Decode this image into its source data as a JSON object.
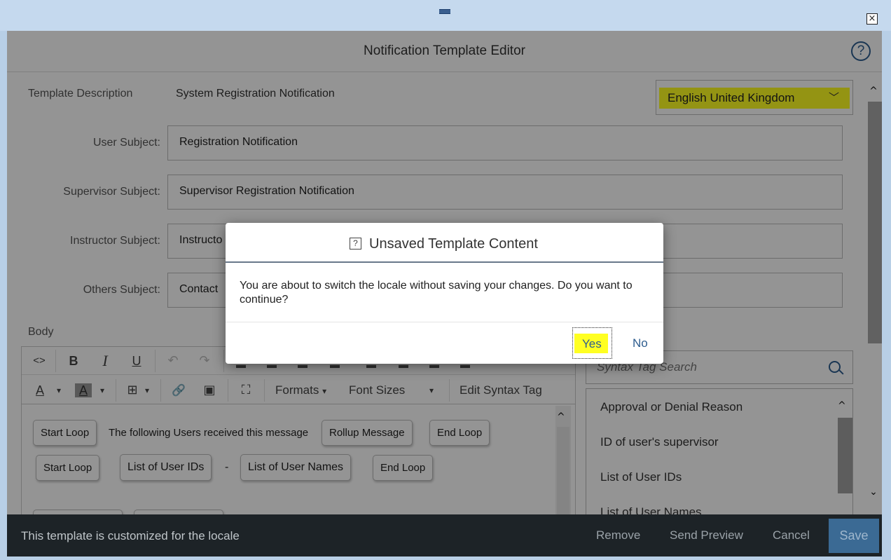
{
  "window": {
    "close_symbol": "×",
    "grip_icon": "drag-handle-icon"
  },
  "editor": {
    "title": "Notification Template Editor",
    "help_symbol": "?",
    "template_description_label": "Template Description",
    "template_description_value": "System Registration Notification",
    "locale_value": "English United Kingdom",
    "locale_chevron": "﹀",
    "fields": [
      {
        "label": "User Subject:",
        "value": "Registration Notification"
      },
      {
        "label": "Supervisor Subject:",
        "value": "Supervisor Registration Notification"
      },
      {
        "label": "Instructor Subject:",
        "value": "Instructo"
      },
      {
        "label": "Others Subject:",
        "value": "Contact"
      }
    ],
    "body_label": "Body",
    "scroll_up": "^",
    "scroll_down": "⌄"
  },
  "toolbar": {
    "source_code": "<>",
    "bold": "B",
    "italic": "I",
    "underline": "U",
    "undo": "↶",
    "redo": "↷",
    "font_color": "A",
    "bg_color": "A",
    "caret": "▾",
    "table": "⊞",
    "link": "🔗",
    "image": "▣",
    "fullscreen": "⛶",
    "formats": "Formats",
    "font_sizes": "Font Sizes",
    "edit_syntax_tag": "Edit Syntax Tag"
  },
  "body_content": {
    "row1": {
      "chip1": "Start Loop",
      "text": "The following Users received this message",
      "chip2": "Rollup Message",
      "chip3": "End Loop"
    },
    "row2": {
      "chip1": "Start Loop",
      "chip2": "List of User IDs",
      "dash": "-",
      "chip3": "List of User Names",
      "chip4": "End Loop"
    }
  },
  "syntax_tags": {
    "search_placeholder": "Syntax Tag Search",
    "items": [
      "Approval or Denial Reason",
      "ID of user's supervisor",
      "List of User IDs",
      "List of User Names"
    ]
  },
  "footer": {
    "status": "This template is customized for the locale",
    "remove": "Remove",
    "send_preview": "Send Preview",
    "cancel": "Cancel",
    "save": "Save"
  },
  "dialog": {
    "icon_symbol": "?",
    "title": "Unsaved Template Content",
    "message": "You are about to switch the locale without saving your changes. Do you want to continue?",
    "yes": "Yes",
    "no": "No"
  },
  "colors": {
    "accent": "#2e5d8f",
    "highlight": "#ffff22",
    "footer_bg": "#1d2327",
    "save_bg": "#3b6a94"
  }
}
